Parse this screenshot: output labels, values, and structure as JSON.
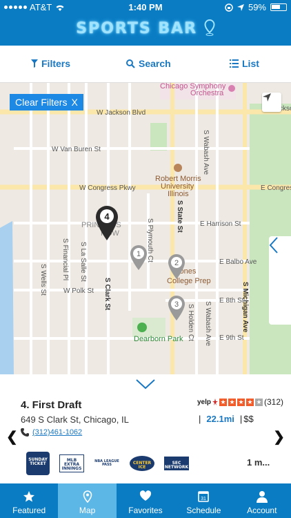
{
  "status_bar": {
    "carrier": "AT&T",
    "time": "1:40 PM",
    "battery": "59%"
  },
  "header": {
    "title": "SPORTS BAR"
  },
  "toolbar": {
    "filters_label": "Filters",
    "search_label": "Search",
    "list_label": "List"
  },
  "map": {
    "clear_filters_label": "Clear Filters",
    "clear_filters_x": "X",
    "labels": {
      "jackson": "W Jackson Blvd",
      "jackson_right": "E Jackson",
      "van_buren": "W Van Buren St",
      "congress": "W Congress Pkwy",
      "congress_right": "E Congress",
      "harrison": "E Harrison St",
      "balbo": "E Balbo Ave",
      "polk": "W Polk St",
      "e8th": "E 8th St",
      "e9th": "E 9th St",
      "wells": "S Wells St",
      "financial": "S Financial Pl",
      "lasalle": "S La Salle St",
      "clark": "S Clark St",
      "plymouth": "S Plymouth Ct",
      "state": "S State St",
      "wabash": "S Wabash Ave",
      "holden": "S Holden Ct",
      "michigan": "S Michigan Ave",
      "symphony1": "Chicago Symphony",
      "symphony2": "Orchestra",
      "rmu1": "Robert Morris",
      "rmu2": "University",
      "rmu3": "Illinois",
      "printers1": "PRINTER'S",
      "printers2": "ROW",
      "jones1": "Jones",
      "jones2": "College Prep",
      "dearborn": "Dearborn Park"
    },
    "pins": [
      {
        "number": "4",
        "selected": true
      },
      {
        "number": "1",
        "selected": false
      },
      {
        "number": "2",
        "selected": false
      },
      {
        "number": "3",
        "selected": false
      }
    ]
  },
  "venue": {
    "title": "4. First Draft",
    "address": "649 S Clark St, Chicago, IL",
    "phone": "(312)461-1062",
    "rating_stars": 4,
    "review_count": "(312)",
    "yelp_label": "yelp",
    "distance": "22.1mi",
    "price": "$$",
    "more_label": "1 m...",
    "logos": [
      "SUNDAY TICKET",
      "MLB EXTRA INNINGS",
      "NBA LEAGUE PASS",
      "CENTER ICE",
      "SEC NETWORK"
    ]
  },
  "tabs": [
    {
      "label": "Featured",
      "icon": "star-icon",
      "active": false
    },
    {
      "label": "Map",
      "icon": "map-pin-icon",
      "active": true
    },
    {
      "label": "Favorites",
      "icon": "heart-icon",
      "active": false
    },
    {
      "label": "Schedule",
      "icon": "calendar-icon",
      "active": false
    },
    {
      "label": "Account",
      "icon": "person-icon",
      "active": false
    }
  ],
  "colors": {
    "brand_blue": "#0a7cc4",
    "active_tab": "#5cb6e6",
    "link_blue": "#1a78c2",
    "yelp_red": "#f15c2a"
  }
}
